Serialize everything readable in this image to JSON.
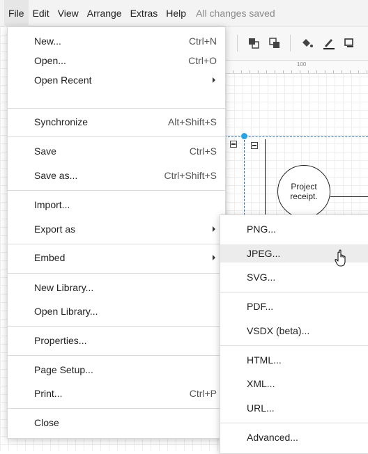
{
  "menubar": {
    "items": [
      "File",
      "Edit",
      "View",
      "Arrange",
      "Extras",
      "Help"
    ],
    "status": "All changes saved"
  },
  "icons": {
    "to_front": "bring-to-front-icon",
    "to_back": "send-to-back-icon",
    "fill": "fill-color-icon",
    "line": "line-color-icon",
    "shadow": "shadow-icon"
  },
  "ruler": {
    "label": "100"
  },
  "diagram": {
    "node_line1": "Project",
    "node_line2": "receipt."
  },
  "file_menu": {
    "new": "New...",
    "new_sc": "Ctrl+N",
    "open": "Open...",
    "open_sc": "Ctrl+O",
    "open_recent": "Open Recent",
    "synchronize": "Synchronize",
    "synchronize_sc": "Alt+Shift+S",
    "save": "Save",
    "save_sc": "Ctrl+S",
    "save_as": "Save as...",
    "save_as_sc": "Ctrl+Shift+S",
    "import": "Import...",
    "export_as": "Export as",
    "embed": "Embed",
    "new_library": "New Library...",
    "open_library": "Open Library...",
    "properties": "Properties...",
    "page_setup": "Page Setup...",
    "print": "Print...",
    "print_sc": "Ctrl+P",
    "close": "Close"
  },
  "export_menu": {
    "png": "PNG...",
    "jpeg": "JPEG...",
    "svg": "SVG...",
    "pdf": "PDF...",
    "vsdx": "VSDX (beta)...",
    "html": "HTML...",
    "xml": "XML...",
    "url": "URL...",
    "advanced": "Advanced..."
  }
}
